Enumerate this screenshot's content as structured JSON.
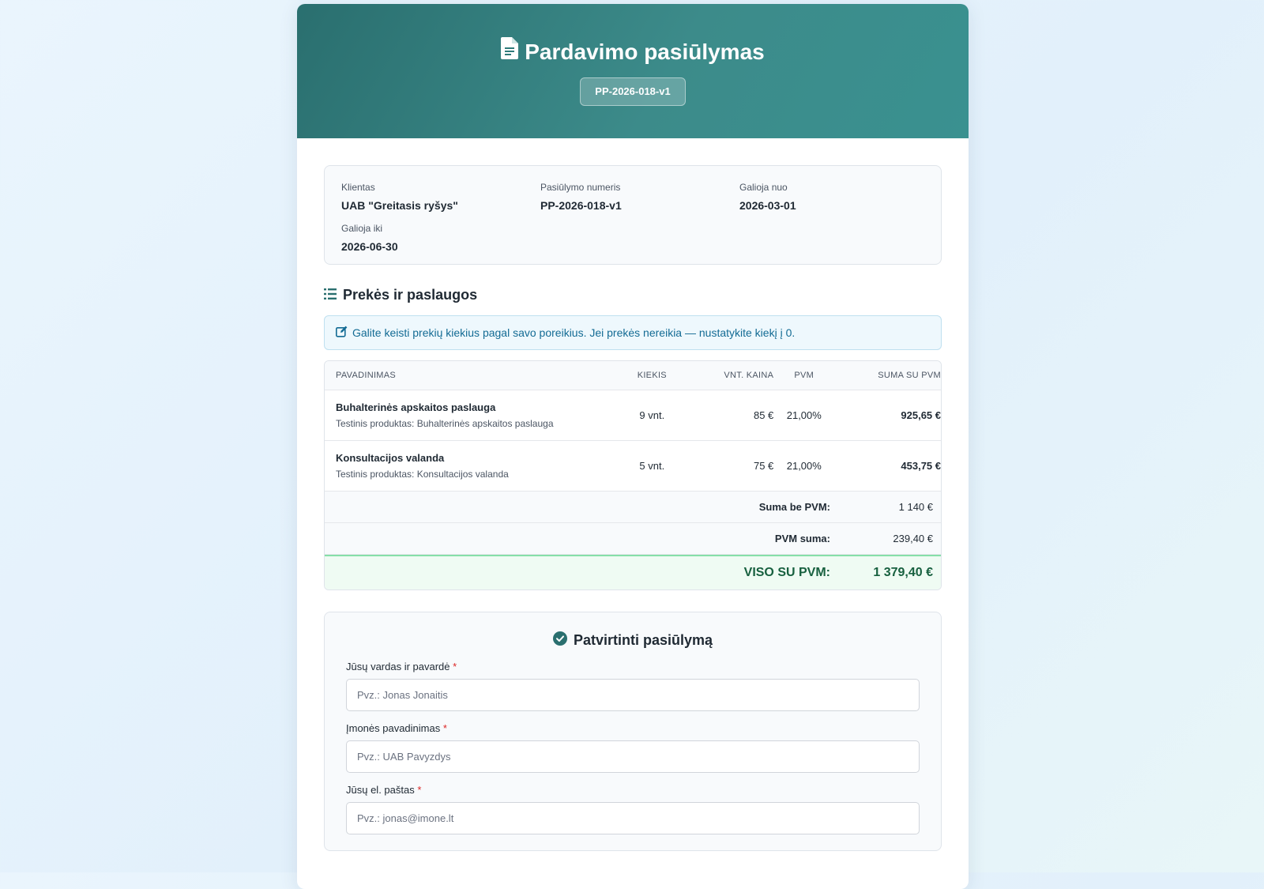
{
  "header": {
    "title": "Pardavimo pasiūlymas",
    "badge": "PP-2026-018-v1"
  },
  "info": [
    {
      "label": "Klientas",
      "value": "UAB \"Greitasis ryšys\""
    },
    {
      "label": "Pasiūlymo numeris",
      "value": "PP-2026-018-v1"
    },
    {
      "label": "Galioja nuo",
      "value": "2026-03-01"
    },
    {
      "label": "Galioja iki",
      "value": "2026-06-30"
    }
  ],
  "items_section": {
    "title": "Prekės ir paslaugos",
    "note": "Galite keisti prekių kiekius pagal savo poreikius. Jei prekės nereikia — nustatykite kiekį į 0."
  },
  "table": {
    "headers": {
      "name": "PAVADINIMAS",
      "qty": "KIEKIS",
      "price": "VNT. KAINA",
      "vat": "PVM",
      "sum": "SUMA SU PVM"
    },
    "rows": [
      {
        "name": "Buhalterinės apskaitos paslauga",
        "desc": "Testinis produktas: Buhalterinės apskaitos paslauga",
        "qty": "9 vnt.",
        "price": "85 €",
        "vat": "21,00%",
        "sum": "925,65 €"
      },
      {
        "name": "Konsultacijos valanda",
        "desc": "Testinis produktas: Konsultacijos valanda",
        "qty": "5 vnt.",
        "price": "75 €",
        "vat": "21,00%",
        "sum": "453,75 €"
      }
    ],
    "subtotal_label": "Suma be PVM:",
    "subtotal_value": "1 140 €",
    "vat_label": "PVM suma:",
    "vat_value": "239,40 €",
    "total_label": "VISO SU PVM:",
    "total_value": "1 379,40 €"
  },
  "confirm": {
    "title": "Patvirtinti pasiūlymą",
    "fields": [
      {
        "label": "Jūsų vardas ir pavardė",
        "required": "*",
        "placeholder": "Pvz.: Jonas Jonaitis"
      },
      {
        "label": "Įmonės pavadinimas",
        "required": "*",
        "placeholder": "Pvz.: UAB Pavyzdys"
      },
      {
        "label": "Jūsų el. paštas",
        "required": "*",
        "placeholder": "Pvz.: jonas@imone.lt"
      }
    ]
  },
  "colors": {
    "header_gradient_start": "#2a6f6f",
    "header_gradient_end": "#3a9190",
    "total_text": "#17603f",
    "note_text": "#136b94",
    "required": "#dc2626"
  }
}
